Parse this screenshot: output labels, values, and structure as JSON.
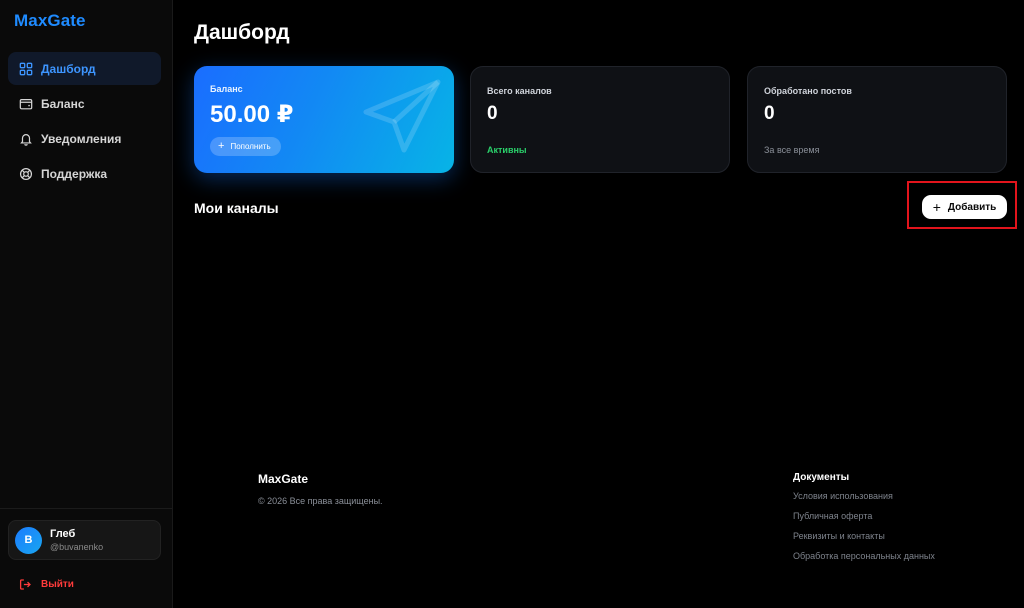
{
  "sidebar": {
    "logo": "MaxGate",
    "items": [
      {
        "label": "Дашборд",
        "icon": "grid-icon",
        "active": true
      },
      {
        "label": "Баланс",
        "icon": "wallet-icon"
      },
      {
        "label": "Уведомления",
        "icon": "bell-icon"
      },
      {
        "label": "Поддержка",
        "icon": "lifebuoy-icon"
      }
    ],
    "user": {
      "initial": "В",
      "name": "Глеб",
      "handle": "@buvanenko"
    },
    "logout_label": "Выйти"
  },
  "main": {
    "title": "Дашборд",
    "cards": {
      "balance": {
        "label": "Баланс",
        "value": "50.00 ₽",
        "topup_label": "Пополнить"
      },
      "channels": {
        "label": "Всего каналов",
        "value": "0",
        "sub": "Активны"
      },
      "posts": {
        "label": "Обработано постов",
        "value": "0",
        "sub": "За все время"
      }
    },
    "section_title": "Мои каналы",
    "add_button_label": "Добавить"
  },
  "footer": {
    "brand": "MaxGate",
    "copyright": "© 2026 Все права защищены.",
    "docs_title": "Документы",
    "links": [
      "Условия использования",
      "Публичная оферта",
      "Реквизиты и контакты",
      "Обработка персональных данных"
    ]
  },
  "colors": {
    "accent": "#1f8bff",
    "danger": "#ff3b3b",
    "success": "#2ad06a",
    "highlight": "#e3141c"
  }
}
